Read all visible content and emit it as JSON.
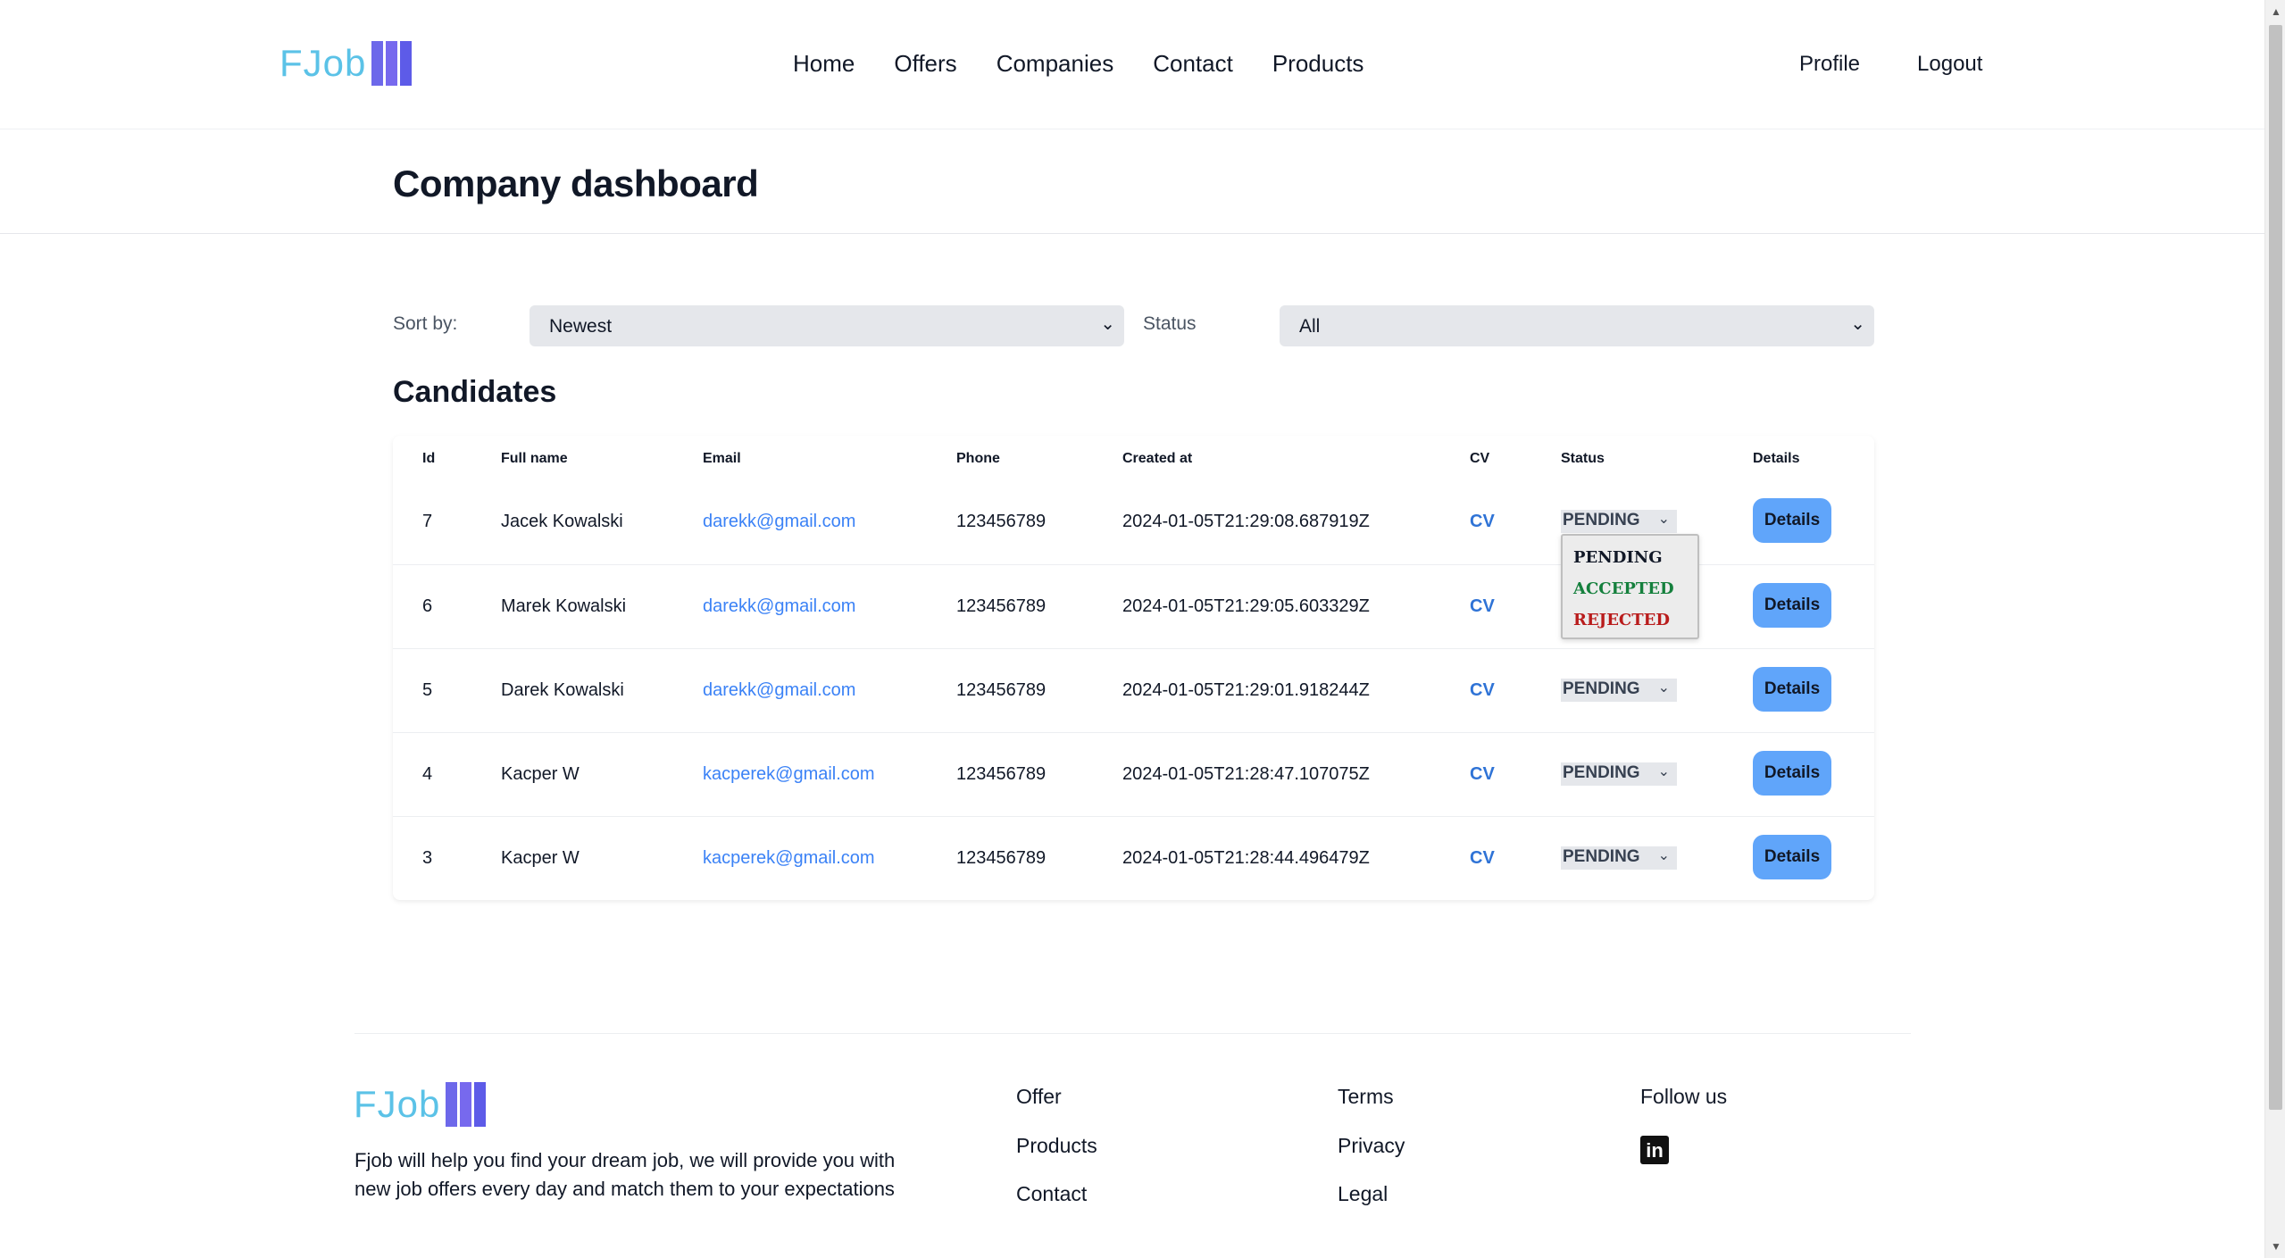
{
  "header": {
    "logo_text": "FJob",
    "nav": [
      "Home",
      "Offers",
      "Companies",
      "Contact",
      "Products"
    ],
    "profile": "Profile",
    "logout": "Logout"
  },
  "page_title": "Company dashboard",
  "filters": {
    "sort_label": "Sort by:",
    "sort_value": "Newest",
    "status_label": "Status",
    "status_value": "All"
  },
  "section_title": "Candidates",
  "table": {
    "headers": [
      "Id",
      "Full name",
      "Email",
      "Phone",
      "Created at",
      "CV",
      "Status",
      "Details"
    ],
    "rows": [
      {
        "id": "7",
        "name": "Jacek Kowalski",
        "email": "darekk@gmail.com",
        "phone": "123456789",
        "created": "2024-01-05T21:29:08.687919Z",
        "cv": "CV",
        "status": "PENDING",
        "details": "Details"
      },
      {
        "id": "6",
        "name": "Marek Kowalski",
        "email": "darekk@gmail.com",
        "phone": "123456789",
        "created": "2024-01-05T21:29:05.603329Z",
        "cv": "CV",
        "status": "PENDING",
        "details": "Details"
      },
      {
        "id": "5",
        "name": "Darek Kowalski",
        "email": "darekk@gmail.com",
        "phone": "123456789",
        "created": "2024-01-05T21:29:01.918244Z",
        "cv": "CV",
        "status": "PENDING",
        "details": "Details"
      },
      {
        "id": "4",
        "name": "Kacper W",
        "email": "kacperek@gmail.com",
        "phone": "123456789",
        "created": "2024-01-05T21:28:47.107075Z",
        "cv": "CV",
        "status": "PENDING",
        "details": "Details"
      },
      {
        "id": "3",
        "name": "Kacper W",
        "email": "kacperek@gmail.com",
        "phone": "123456789",
        "created": "2024-01-05T21:28:44.496479Z",
        "cv": "CV",
        "status": "PENDING",
        "details": "Details"
      }
    ]
  },
  "status_dropdown": {
    "options": [
      "PENDING",
      "ACCEPTED",
      "REJECTED"
    ],
    "colors": {
      "PENDING": "#111827",
      "ACCEPTED": "#15803d",
      "REJECTED": "#b91c1c"
    }
  },
  "footer": {
    "logo_text": "FJob",
    "description": "Fjob will help you find your dream job, we will provide you with new job offers every day and match them to your expectations",
    "col1": [
      "Offer",
      "Products",
      "Contact"
    ],
    "col2": [
      "Terms",
      "Privacy",
      "Legal"
    ],
    "follow": "Follow us",
    "social_icon": "linkedin-icon"
  },
  "colors": {
    "logo_text": "#5bc2e7",
    "logo_bars": "#6d68ea",
    "link": "#3b82f6",
    "details_button": "#60a5fa"
  }
}
